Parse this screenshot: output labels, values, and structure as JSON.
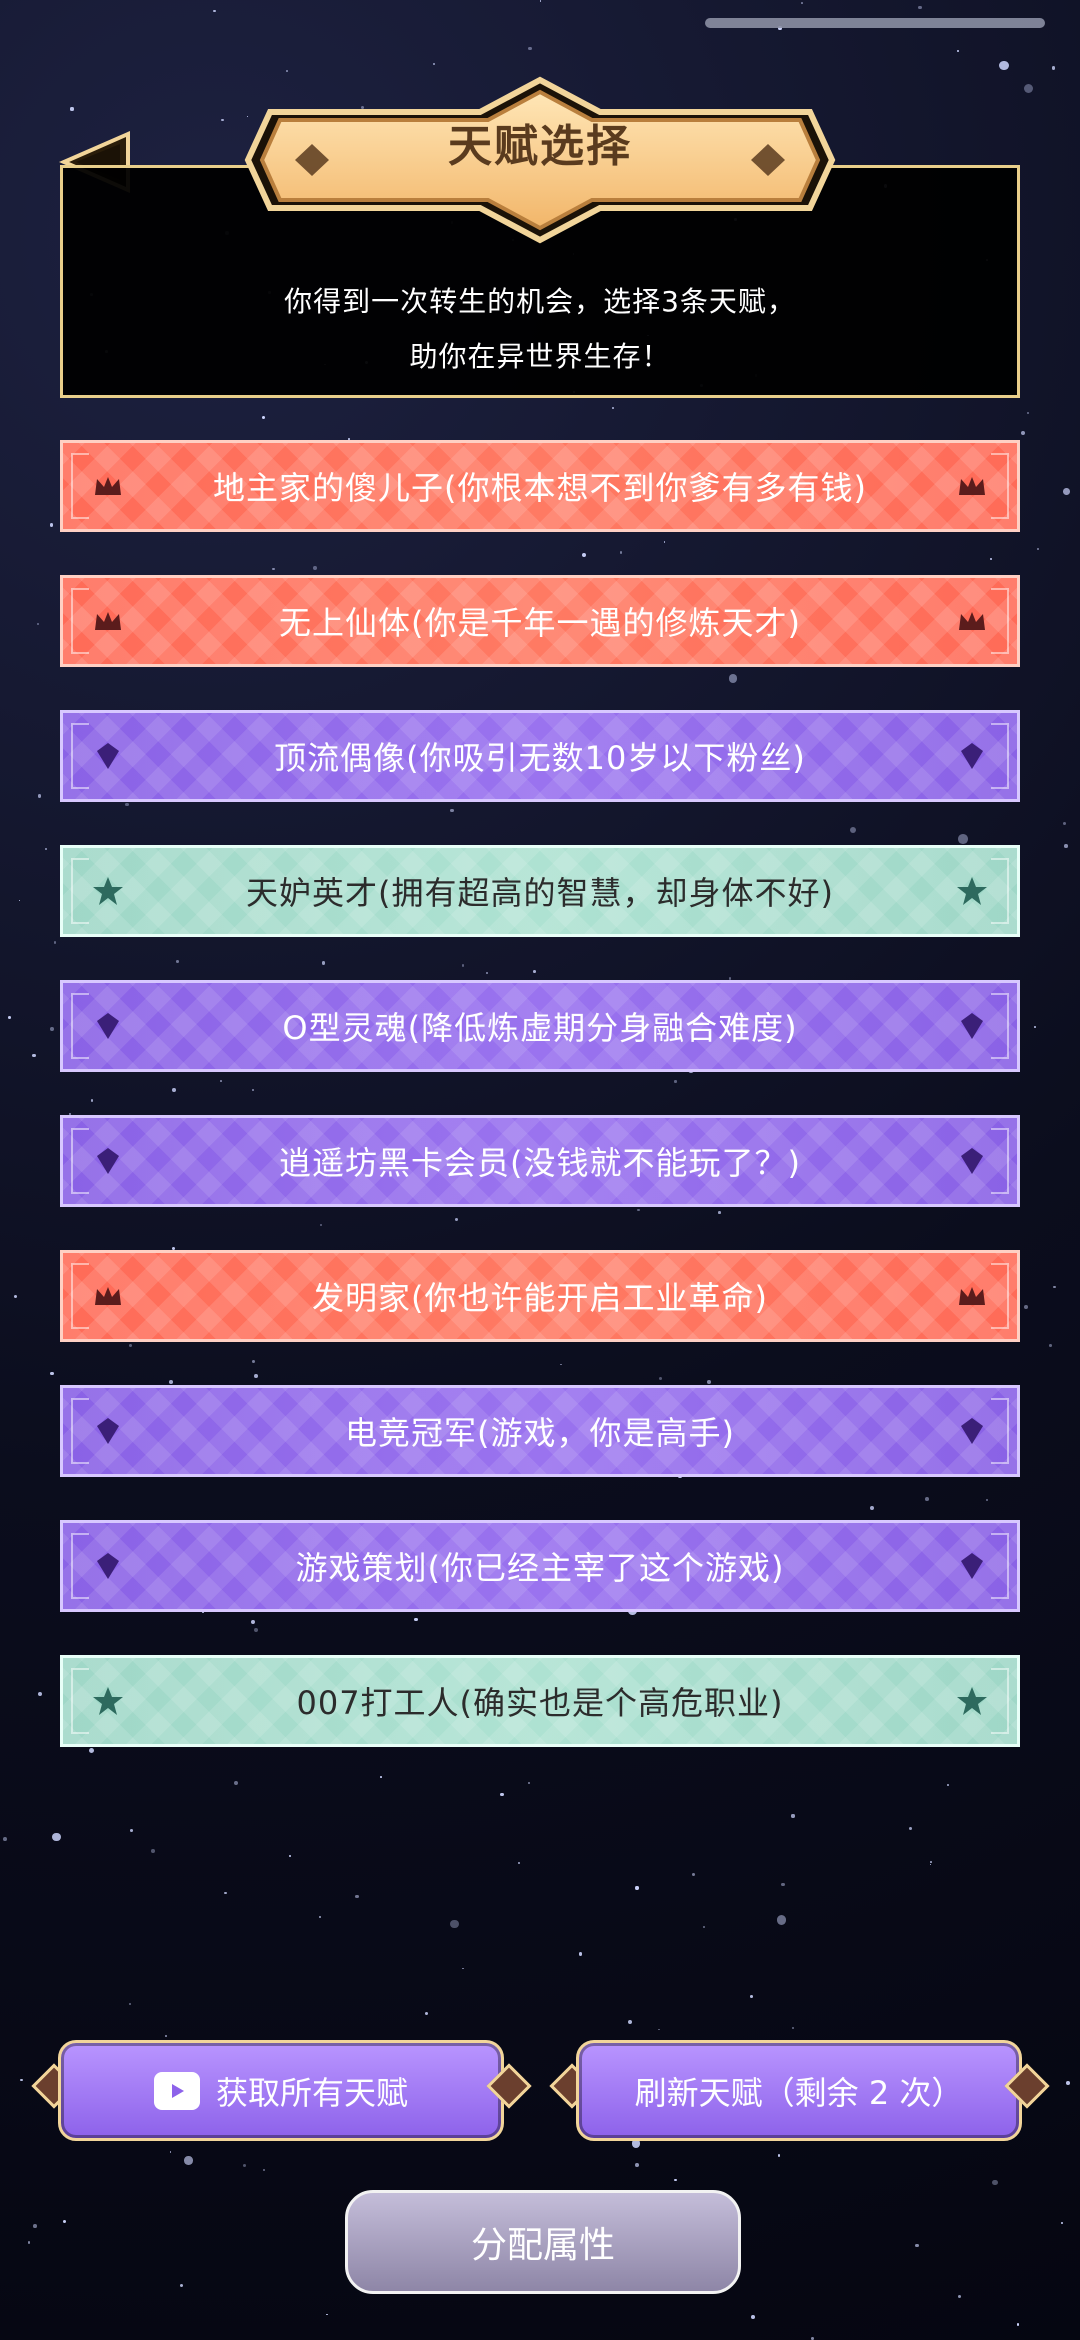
{
  "header": {
    "title": "天赋选择",
    "intro_lines": [
      "你得到一次转生的机会，选择3条天赋，",
      "助你在异世界生存！"
    ]
  },
  "talents": [
    {
      "label": "地主家的傻儿子(你根本想不到你爹有多有钱)",
      "tier": "red",
      "icon": "crown-icon"
    },
    {
      "label": "无上仙体(你是千年一遇的修炼天才)",
      "tier": "red",
      "icon": "crown-icon"
    },
    {
      "label": "顶流偶像(你吸引无数10岁以下粉丝)",
      "tier": "purple",
      "icon": "diamond-icon"
    },
    {
      "label": "天妒英才(拥有超高的智慧，却身体不好)",
      "tier": "teal",
      "icon": "star-icon"
    },
    {
      "label": "O型灵魂(降低炼虚期分身融合难度)",
      "tier": "purple",
      "icon": "diamond-icon"
    },
    {
      "label": "逍遥坊黑卡会员(没钱就不能玩了？)",
      "tier": "purple",
      "icon": "diamond-icon"
    },
    {
      "label": "发明家(你也许能开启工业革命)",
      "tier": "red",
      "icon": "crown-icon"
    },
    {
      "label": "电竞冠军(游戏，你是高手)",
      "tier": "purple",
      "icon": "diamond-icon"
    },
    {
      "label": "游戏策划(你已经主宰了这个游戏)",
      "tier": "purple",
      "icon": "diamond-icon"
    },
    {
      "label": "007打工人(确实也是个高危职业)",
      "tier": "teal",
      "icon": "star-icon"
    }
  ],
  "buttons": {
    "get_all_talents": "获取所有天赋",
    "refresh_talents": "刷新天赋（剩余 2 次）",
    "allocate_attributes": "分配属性"
  },
  "colors": {
    "red_tier": "#ff6b58",
    "purple_tier": "#8a62e6",
    "teal_tier": "#9fd7c7",
    "gold_border": "#e9cf8b"
  }
}
